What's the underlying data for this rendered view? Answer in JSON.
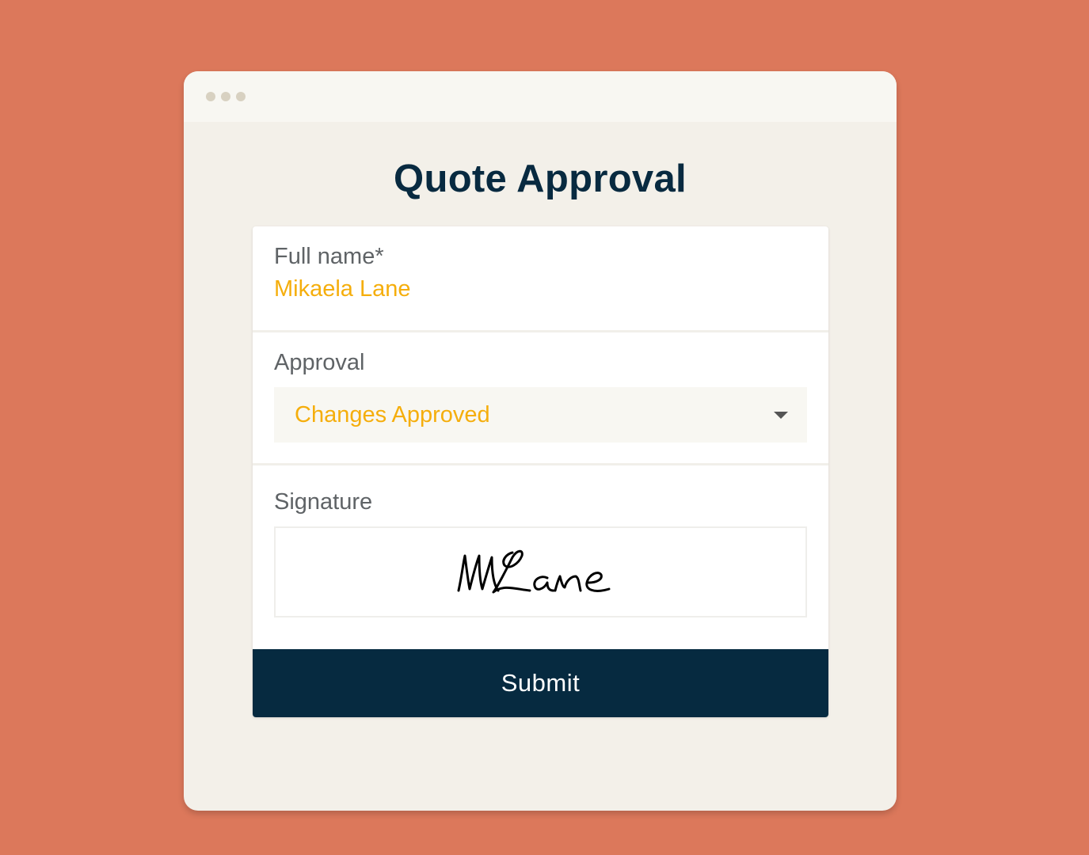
{
  "window": {
    "controls": [
      "dot",
      "dot",
      "dot"
    ]
  },
  "form": {
    "title": "Quote Approval",
    "full_name": {
      "label": "Full name*",
      "value": "Mikaela Lane"
    },
    "approval": {
      "label": "Approval",
      "selected": "Changes Approved",
      "icon": "chevron-down-icon"
    },
    "signature": {
      "label": "Signature",
      "signed_text": "MLane"
    },
    "submit_label": "Submit"
  },
  "colors": {
    "background": "#dc785b",
    "window": "#f3f0e9",
    "titlebar": "#f8f7f2",
    "accent_value": "#f5ae0c",
    "primary": "#062a40",
    "label": "#5f6366"
  }
}
